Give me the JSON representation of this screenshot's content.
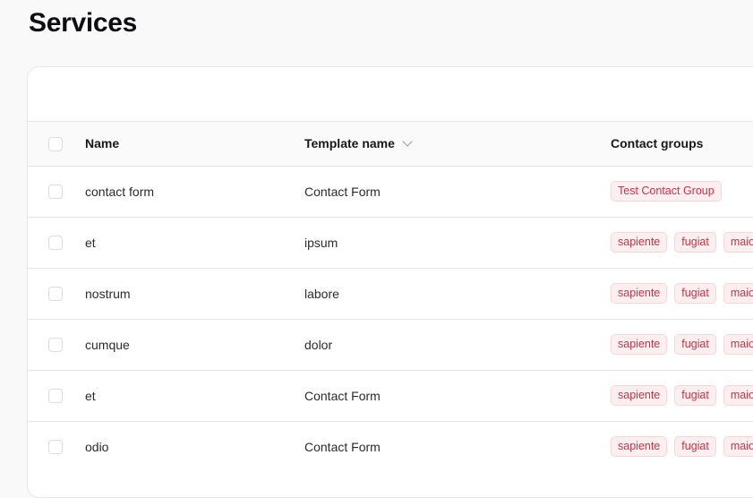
{
  "page": {
    "title": "Services"
  },
  "table": {
    "columns": {
      "name": "Name",
      "template": "Template name",
      "groups": "Contact groups"
    },
    "rows": [
      {
        "name": "contact form",
        "template": "Contact Form",
        "groups": [
          "Test Contact Group"
        ]
      },
      {
        "name": "et",
        "template": "ipsum",
        "groups": [
          "sapiente",
          "fugiat",
          "maio"
        ]
      },
      {
        "name": "nostrum",
        "template": "labore",
        "groups": [
          "sapiente",
          "fugiat",
          "maio"
        ]
      },
      {
        "name": "cumque",
        "template": "dolor",
        "groups": [
          "sapiente",
          "fugiat",
          "maio"
        ]
      },
      {
        "name": "et",
        "template": "Contact Form",
        "groups": [
          "sapiente",
          "fugiat",
          "maio"
        ]
      },
      {
        "name": "odio",
        "template": "Contact Form",
        "groups": [
          "sapiente",
          "fugiat",
          "maio"
        ]
      }
    ]
  },
  "colors": {
    "tag_text": "#c2354a",
    "tag_background": "#fdeef0",
    "page_background": "#f9f9f9"
  }
}
